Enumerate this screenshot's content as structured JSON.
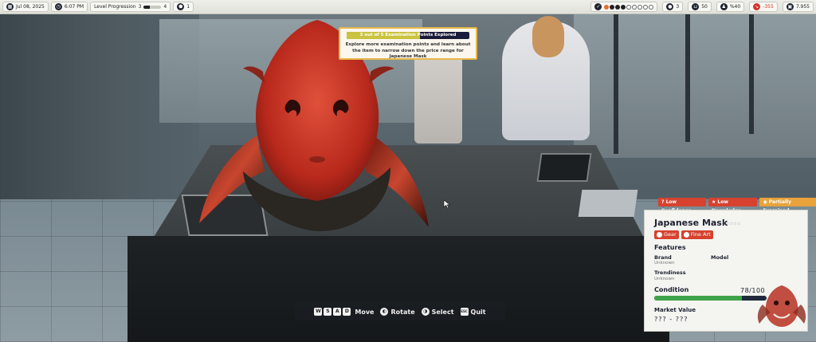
{
  "hud": {
    "date": "Jul 08, 2025",
    "time": "6:07 PM",
    "level_label": "Level Progression",
    "level_from": "3",
    "level_to": "4",
    "level_progress": 0.35,
    "reputation": "1",
    "items": "3",
    "sales": "50",
    "followers": "%40",
    "profit": "-355",
    "cash": "7.955"
  },
  "exam": {
    "progress_label": "3 out of 5 Examination Points Explored",
    "explored": 3,
    "total": 5,
    "hint": "Explore more examination points and learn about the item to narrow down the price range for Japanese Mask"
  },
  "controls": {
    "keys": [
      "W",
      "S",
      "A",
      "D"
    ],
    "move": "Move",
    "rotate": "Rotate",
    "select": "Select",
    "quit_key": "ESC",
    "quit": "Quit"
  },
  "badges": {
    "confidence": "Low Confidence",
    "knowledge": "Low Knowledge",
    "examined": "Partially Examined"
  },
  "item": {
    "name": "Japanese Mask",
    "stars": "☆☆☆☆☆",
    "category_1": "Gear",
    "category_2": "Fine Art",
    "features_title": "Features",
    "brand_label": "Brand",
    "brand_value": "Unknown",
    "model_label": "Model",
    "trendiness_label": "Trendiness",
    "trendiness_value": "Unknown",
    "condition_label": "Condition",
    "condition_value": "78/100",
    "condition": 78,
    "market_label": "Market Value",
    "market_value": "??? - ???"
  },
  "colors": {
    "accent_red": "#d6422f",
    "badge_orange": "#e8a33a",
    "condition_green": "#3ea34a",
    "exam_border": "#e7b84a"
  }
}
